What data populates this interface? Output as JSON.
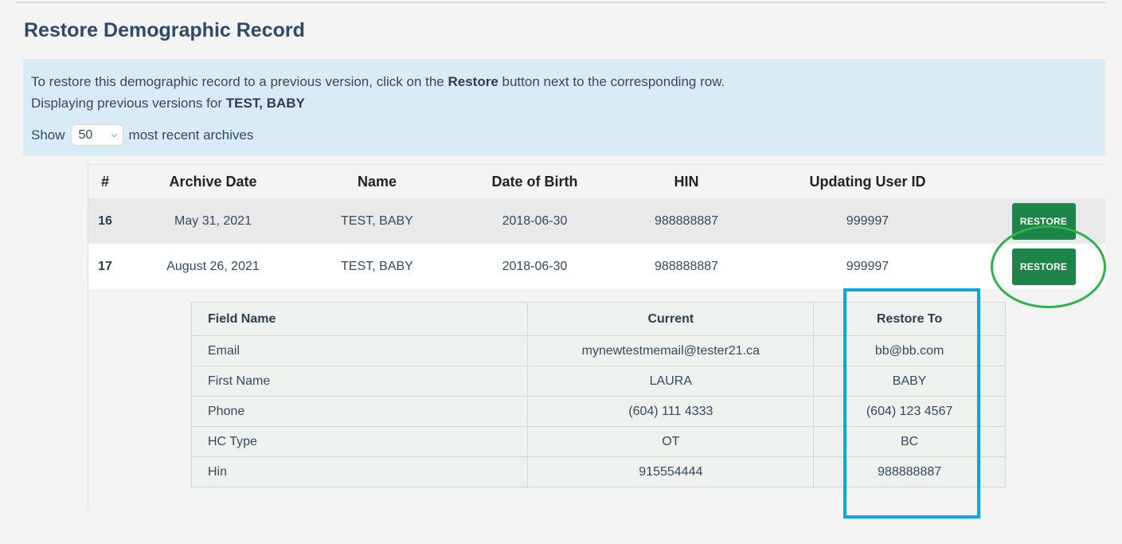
{
  "page": {
    "title": "Restore Demographic Record"
  },
  "info": {
    "line1_prefix": "To restore this demographic record to a previous version, click on the ",
    "line1_bold": "Restore",
    "line1_suffix": " button next to the corresponding row.",
    "line2_prefix": "Displaying previous versions for ",
    "line2_bold": "TEST, BABY",
    "show_label": "Show",
    "show_value": "50",
    "show_suffix": "most recent archives"
  },
  "archive_table": {
    "headers": [
      "#",
      "Archive Date",
      "Name",
      "Date of Birth",
      "HIN",
      "Updating User ID",
      ""
    ],
    "rows": [
      {
        "num": "16",
        "archive_date": "May 31, 2021",
        "name": "TEST, BABY",
        "dob": "2018-06-30",
        "hin": "988888887",
        "user_id": "999997",
        "action": "RESTORE"
      },
      {
        "num": "17",
        "archive_date": "August 26, 2021",
        "name": "TEST, BABY",
        "dob": "2018-06-30",
        "hin": "988888887",
        "user_id": "999997",
        "action": "RESTORE"
      }
    ]
  },
  "detail_table": {
    "headers": [
      "Field Name",
      "Current",
      "Restore To"
    ],
    "rows": [
      {
        "field": "Email",
        "current": "mynewtestmemail@tester21.ca",
        "restore_to": "bb@bb.com"
      },
      {
        "field": "First Name",
        "current": "LAURA",
        "restore_to": "BABY"
      },
      {
        "field": "Phone",
        "current": "(604) 111 4333",
        "restore_to": "(604) 123 4567"
      },
      {
        "field": "HC Type",
        "current": "OT",
        "restore_to": "BC"
      },
      {
        "field": "Hin",
        "current": "915554444",
        "restore_to": "988888887"
      }
    ]
  },
  "colors": {
    "title": "#2e4a6b",
    "info_bg": "#d9ebf5",
    "restore_button": "#1e8449",
    "highlight_green": "#2db34a",
    "highlight_blue": "#0ea5e0"
  },
  "icons": {
    "select_chevron": "chevron-down-icon"
  }
}
